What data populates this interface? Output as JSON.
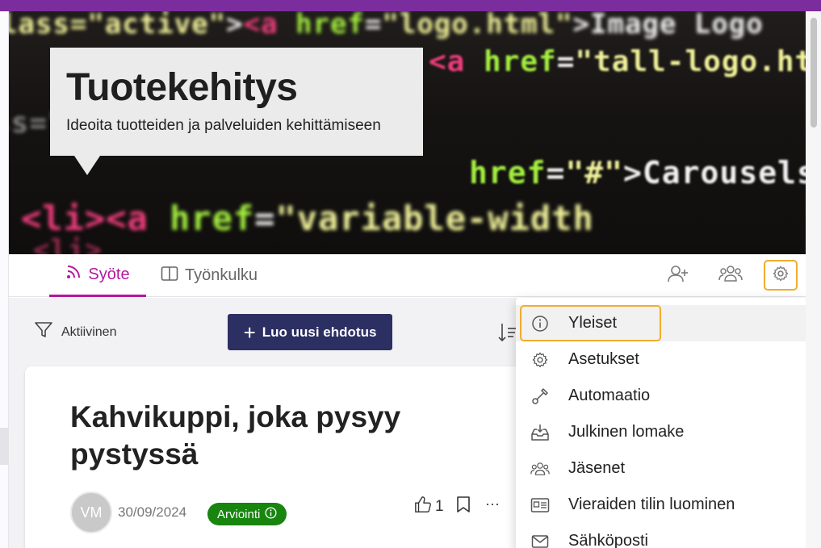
{
  "banner": {
    "title": "Tuotekehitys",
    "subtitle": "Ideoita tuotteiden ja palveluiden kehittämiseen"
  },
  "tabs": {
    "feed_label": "Syöte",
    "workflow_label": "Työnkulku"
  },
  "toolbar": {
    "filter_label": "Aktiivinen",
    "create_label": "Luo uusi ehdotus"
  },
  "post": {
    "title": "Kahvikuppi, joka pysyy pystyssä",
    "author_initials": "VM",
    "date": "30/09/2024",
    "status": "Arviointi",
    "likes": "1"
  },
  "settings_menu": {
    "items": [
      {
        "label": "Yleiset",
        "icon": "info-icon"
      },
      {
        "label": "Asetukset",
        "icon": "gear-icon"
      },
      {
        "label": "Automaatio",
        "icon": "automation-icon"
      },
      {
        "label": "Julkinen lomake",
        "icon": "inbox-download-icon"
      },
      {
        "label": "Jäsenet",
        "icon": "members-icon"
      },
      {
        "label": "Vieraiden tilin luominen",
        "icon": "id-card-icon"
      },
      {
        "label": "Sähköposti",
        "icon": "mail-icon"
      }
    ]
  },
  "colors": {
    "accent": "#b5179e",
    "primary_button": "#2c2f62",
    "status_green": "#17850e",
    "focus": "#f0ad2e",
    "top_bar": "#7b2d9e"
  }
}
